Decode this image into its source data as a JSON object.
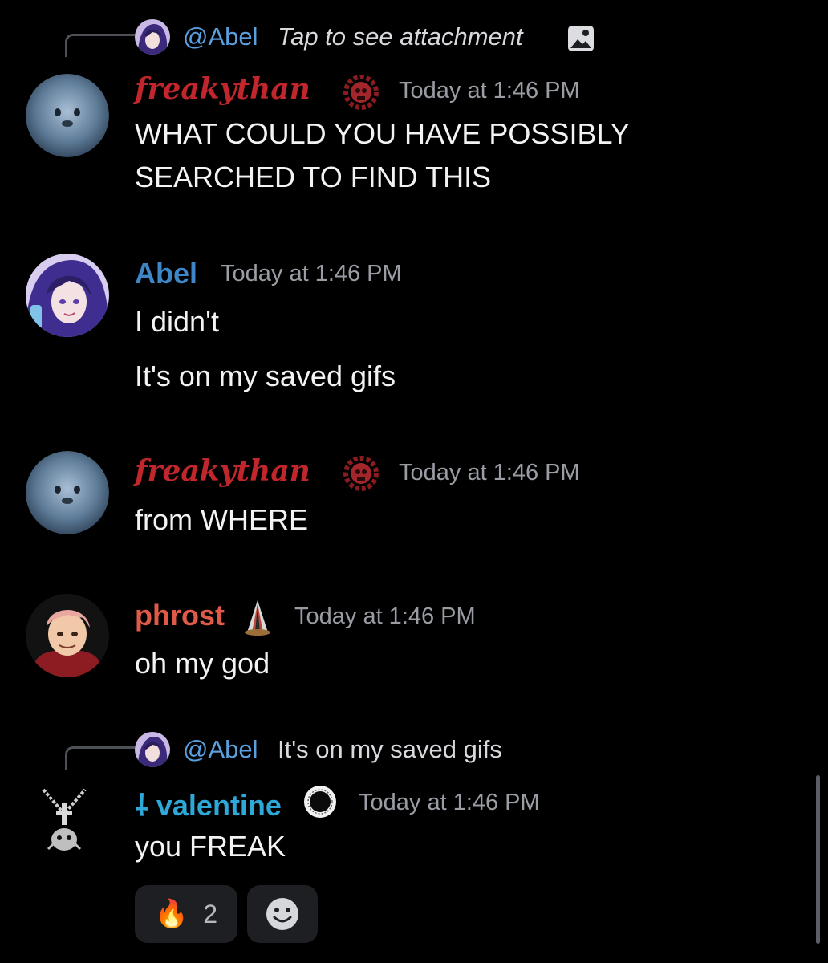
{
  "messages": [
    {
      "reply": {
        "mention": "@Abel",
        "text": "Tap to see attachment",
        "icon": "image-icon"
      },
      "username": "freakythan",
      "username_color": "#c0262b",
      "badge_icon": "gear-skull-icon",
      "timestamp": "Today at 1:46 PM",
      "lines": [
        "WHAT COULD YOU HAVE POSSIBLY",
        "SEARCHED TO FIND THIS"
      ]
    },
    {
      "username": "Abel",
      "username_color": "#3f86c6",
      "timestamp": "Today at 1:46 PM",
      "lines": [
        "I didn't",
        "It's on my saved gifs"
      ]
    },
    {
      "username": "freakythan",
      "username_color": "#c0262b",
      "badge_icon": "gear-skull-icon",
      "timestamp": "Today at 1:46 PM",
      "lines": [
        "from WHERE"
      ]
    },
    {
      "username": "phrost",
      "username_color": "#e05a4a",
      "badge_icon": "cloak-figure-icon",
      "timestamp": "Today at 1:46 PM",
      "lines": [
        "oh my god"
      ]
    },
    {
      "reply": {
        "mention": "@Abel",
        "text": "It's on my saved gifs"
      },
      "username": "⸸ valentine",
      "username_color": "#2ea8d9",
      "badge_icon": "eclipse-ring-icon",
      "timestamp": "Today at 1:46 PM",
      "lines": [
        "you FREAK"
      ],
      "reactions": [
        {
          "emoji": "🔥",
          "count": "2"
        }
      ]
    }
  ]
}
